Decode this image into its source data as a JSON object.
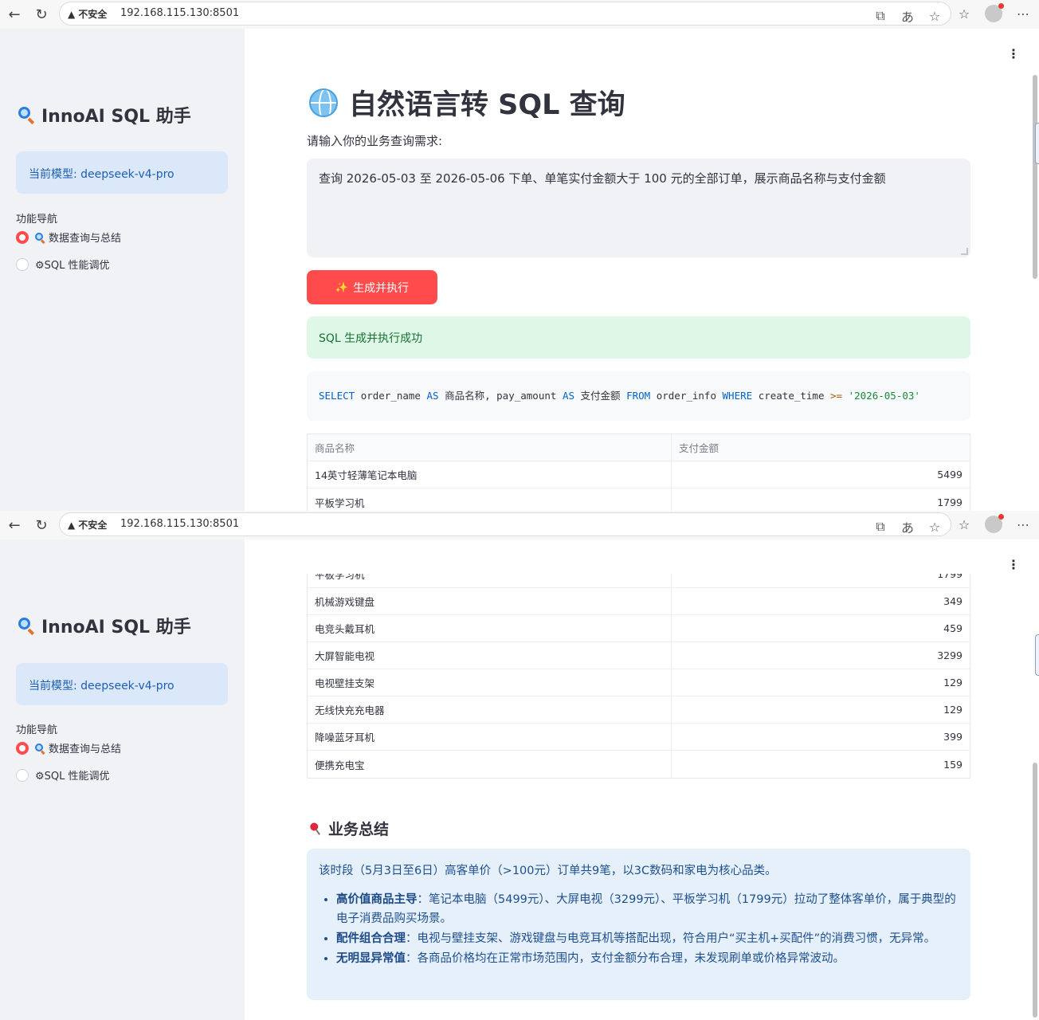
{
  "browser": {
    "security_label": "不安全",
    "url": "192.168.115.130:8501"
  },
  "sidebar": {
    "app_title": "InnoAI SQL 助手",
    "model_label": "当前模型: deepseek-v4-pro",
    "nav_heading": "功能导航",
    "nav_items": [
      {
        "label": "数据查询与总结",
        "selected": true,
        "icon": "magnifier-icon"
      },
      {
        "label": "⚙SQL 性能调优",
        "selected": false,
        "icon": "gear-icon"
      }
    ]
  },
  "main": {
    "title": "自然语言转 SQL 查询",
    "input_label": "请输入你的业务查询需求:",
    "query_text": "查询 2026-05-03 至 2026-05-06 下单、单笔实付金额大于 100 元的全部订单，展示商品名称与支付金额",
    "run_button": "生成并执行",
    "success_message": "SQL 生成并执行成功",
    "sql": {
      "select": "SELECT",
      "col1": "order_name",
      "as1": "AS",
      "alias1": "商品名称,",
      "col2": "pay_amount",
      "as2": "AS",
      "alias2": "支付金额",
      "from": "FROM",
      "table": "order_info",
      "where": "WHERE",
      "field": "create_time",
      "op": ">=",
      "value": "'2026-05-03'"
    },
    "table": {
      "headers": [
        "商品名称",
        "支付金额"
      ],
      "rows": [
        [
          "14英寸轻薄笔记本电脑",
          "5499"
        ],
        [
          "平板学习机",
          "1799"
        ],
        [
          "机械游戏键盘",
          "349"
        ],
        [
          "电竞头戴耳机",
          "459"
        ],
        [
          "大屏智能电视",
          "3299"
        ],
        [
          "电视壁挂支架",
          "129"
        ],
        [
          "无线快充充电器",
          "129"
        ],
        [
          "降噪蓝牙耳机",
          "399"
        ],
        [
          "便携充电宝",
          "159"
        ]
      ]
    },
    "summary": {
      "title": "业务总结",
      "intro": "该时段（5月3日至6日）高客单价（>100元）订单共9笔，以3C数码和家电为核心品类。",
      "bullets": [
        {
          "bold": "高价值商品主导",
          "text": "：笔记本电脑（5499元）、大屏电视（3299元）、平板学习机（1799元）拉动了整体客单价，属于典型的电子消费品购买场景。"
        },
        {
          "bold": "配件组合合理",
          "text": "：电视与壁挂支架、游戏键盘与电竞耳机等搭配出现，符合用户“买主机+买配件”的消费习惯，无异常。"
        },
        {
          "bold": "无明显异常值",
          "text": "：各商品价格均在正常市场范围内，支付金额分布合理，未发现刷单或价格异常波动。"
        }
      ]
    }
  },
  "colors": {
    "accent": "#ff4b4b",
    "sidebar_bg": "#f0f2f6",
    "info_bg": "#dbe8fa",
    "success_bg": "#dff7e6"
  }
}
